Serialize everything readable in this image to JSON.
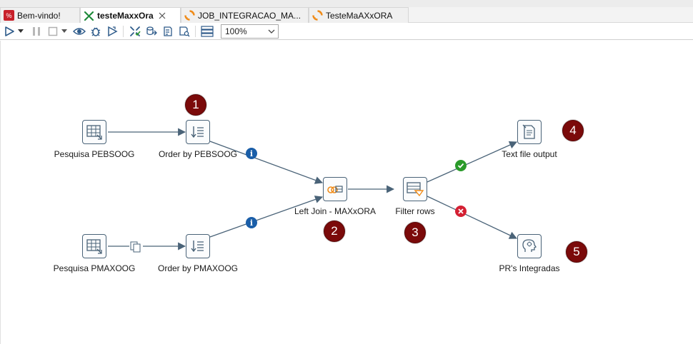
{
  "tabs": [
    {
      "label": "Bem-vindo!",
      "icon": "spoon-icon",
      "active": false
    },
    {
      "label": "testeMaxxOra",
      "icon": "transformation-icon",
      "active": true
    },
    {
      "label": "JOB_INTEGRACAO_MA...",
      "icon": "job-icon",
      "active": false
    },
    {
      "label": "TesteMaAXxORA",
      "icon": "job-icon",
      "active": false
    }
  ],
  "toolbar": {
    "zoom_value": "100%"
  },
  "steps": {
    "pesquisa_pebsoog": {
      "label": "Pesquisa PEBSOOG",
      "icon": "table-input-icon"
    },
    "order_pebsoog": {
      "label": "Order by PEBSOOG",
      "icon": "sort-rows-icon"
    },
    "pesquisa_pmaxoog": {
      "label": "Pesquisa PMAXOOG",
      "icon": "table-input-icon"
    },
    "order_pmaxoog": {
      "label": "Order by PMAXOOG",
      "icon": "sort-rows-icon"
    },
    "left_join": {
      "label": "Left Join - MAXxORA",
      "icon": "merge-join-icon"
    },
    "filter_rows": {
      "label": "Filter rows",
      "icon": "filter-rows-icon"
    },
    "text_file_output": {
      "label": "Text file output",
      "icon": "text-file-output-icon"
    },
    "prs_integradas": {
      "label": "PR's Integradas",
      "icon": "user-defined-icon"
    }
  },
  "badges": [
    "1",
    "2",
    "3",
    "4",
    "5"
  ],
  "hop_icons": {
    "info_1": "i",
    "info_2": "i"
  },
  "colors": {
    "badge": "#7b0a0a",
    "hop": "#4a6378",
    "info": "#1a5ea8",
    "ok": "#2a9a2a",
    "error": "#d42033"
  }
}
